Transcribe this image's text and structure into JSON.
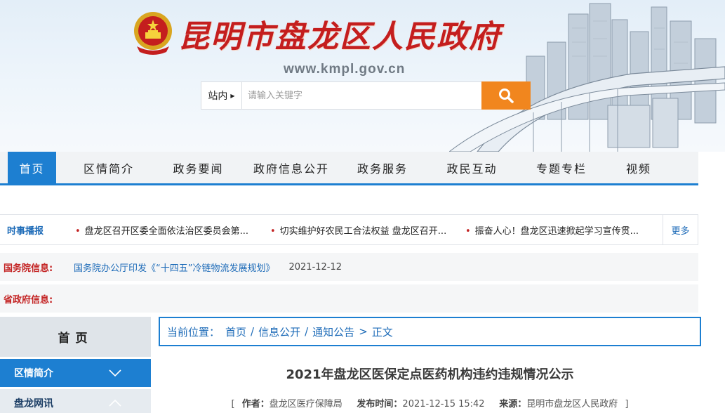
{
  "header": {
    "site_title": "昆明市盘龙区人民政府",
    "site_url": "www.kmpl.gov.cn",
    "search": {
      "scope": "站内",
      "placeholder": "请输入关键字"
    }
  },
  "nav": {
    "items": [
      "首页",
      "区情简介",
      "政务要闻",
      "政府信息公开",
      "政务服务",
      "政民互动",
      "专题专栏",
      "视频"
    ],
    "active_index": 0
  },
  "ticker": {
    "label": "时事播报",
    "items": [
      "盘龙区召开区委全面依法治区委员会第...",
      "切实维护好农民工合法权益 盘龙区召开...",
      "振奋人心！盘龙区迅速掀起学习宣传贯..."
    ],
    "more": "更多"
  },
  "state_council": {
    "label": "国务院信息:",
    "link": "国务院办公厅印发《“十四五”冷链物流发展规划》",
    "date": "2021-12-12"
  },
  "provincial": {
    "label": "省政府信息:"
  },
  "sidebar": {
    "home": "首页",
    "items": [
      "区情简介",
      "盘龙网讯"
    ]
  },
  "breadcrumb": {
    "prefix": "当前位置：",
    "items": [
      "首页",
      "信息公开",
      "通知公告",
      "正文"
    ]
  },
  "article": {
    "title": "2021年盘龙区医保定点医药机构违约违规情况公示",
    "author_label": "作者：",
    "author": "盘龙区医疗保障局",
    "time_label": "发布时间：",
    "time": "2021-12-15 15:42",
    "source_label": "来源：",
    "source": "昆明市盘龙区人民政府"
  },
  "colors": {
    "brand_blue": "#1d7fd1",
    "title_red": "#c41e1e",
    "search_orange": "#f1861e"
  }
}
